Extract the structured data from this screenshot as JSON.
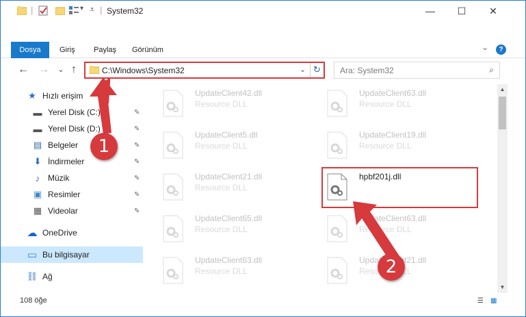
{
  "window": {
    "title": "System32",
    "minimize_glyph": "—",
    "maximize_glyph": "☐",
    "close_glyph": "✕"
  },
  "ribbon": {
    "tabs": [
      "Dosya",
      "Giriş",
      "Paylaş",
      "Görünüm"
    ],
    "expand_glyph": "⌄",
    "help_glyph": "?"
  },
  "address": {
    "path": "C:\\Windows\\System32",
    "back_glyph": "←",
    "forward_glyph": "→",
    "recent_glyph": "⌄",
    "up_glyph": "↑",
    "dropdown_glyph": "⌄",
    "refresh_glyph": "↻"
  },
  "search": {
    "placeholder": "Ara: System32",
    "icon_glyph": "⌕"
  },
  "sidebar": {
    "items": [
      {
        "label": "Hızlı erişim",
        "icon": "star-icon",
        "glyph": "★",
        "pinned": false
      },
      {
        "label": "Yerel Disk (C:)",
        "icon": "drive-icon",
        "glyph": "▬",
        "pinned": true
      },
      {
        "label": "Yerel Disk (D:)",
        "icon": "drive-icon",
        "glyph": "▬",
        "pinned": true
      },
      {
        "label": "Belgeler",
        "icon": "documents-icon",
        "glyph": "▤",
        "pinned": true
      },
      {
        "label": "İndirmeler",
        "icon": "download-icon",
        "glyph": "⬇",
        "pinned": true
      },
      {
        "label": "Müzik",
        "icon": "music-icon",
        "glyph": "♪",
        "pinned": true
      },
      {
        "label": "Resimler",
        "icon": "pictures-icon",
        "glyph": "▣",
        "pinned": true
      },
      {
        "label": "Videolar",
        "icon": "videos-icon",
        "glyph": "▦",
        "pinned": true
      },
      {
        "label": "OneDrive",
        "icon": "cloud-icon",
        "glyph": "☁",
        "pinned": false
      },
      {
        "label": "Bu bilgisayar",
        "icon": "computer-icon",
        "glyph": "▭",
        "pinned": false,
        "selected": true
      },
      {
        "label": "Ağ",
        "icon": "network-icon",
        "glyph": "⛓",
        "pinned": false
      }
    ],
    "pin_glyph": "✎"
  },
  "files": [
    {
      "name": "UpdateClient42.dll",
      "desc": "Resource DLL",
      "faded": true
    },
    {
      "name": "UpdateClient63.dll",
      "desc": "Resource DLL",
      "faded": true
    },
    {
      "name": "UpdateClient5.dll",
      "desc": "Resource DLL",
      "faded": true
    },
    {
      "name": "UpdateClient19.dll",
      "desc": "Resource DLL",
      "faded": true
    },
    {
      "name": "UpdateClient21.dll",
      "desc": "Resource DLL",
      "faded": true
    },
    {
      "name": "hpbf201j.dll",
      "desc": "",
      "faded": false
    },
    {
      "name": "UpdateClient65.dll",
      "desc": "Resource DLL",
      "faded": true
    },
    {
      "name": "UpdateClient63.dll",
      "desc": "Resource DLL",
      "faded": true
    },
    {
      "name": "UpdateClient63.dll",
      "desc": "Resource DLL",
      "faded": true
    },
    {
      "name": "UpdateClient21.dll",
      "desc": "Resource DLL",
      "faded": true
    }
  ],
  "status": {
    "item_count": "108 öğe"
  },
  "annotations": {
    "step1": "1",
    "step2": "2",
    "color": "#d63a3d"
  },
  "colors": {
    "accent": "#1979ca",
    "selection": "#cce8ff",
    "highlight_border": "#d9383a"
  }
}
